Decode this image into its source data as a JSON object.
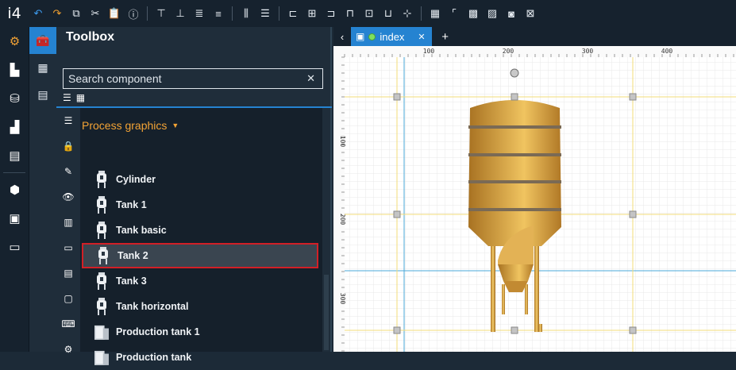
{
  "app": {
    "logo": "i4"
  },
  "toolbar": {
    "groups": [
      [
        {
          "name": "undo-icon",
          "glyph": "↶",
          "cls": "blue"
        },
        {
          "name": "redo-icon",
          "glyph": "↷",
          "cls": "orange"
        },
        {
          "name": "copy-icon",
          "glyph": "⧉",
          "cls": ""
        },
        {
          "name": "cut-icon",
          "glyph": "✂",
          "cls": ""
        },
        {
          "name": "paste-icon",
          "glyph": "📋",
          "cls": ""
        },
        {
          "name": "info-icon",
          "glyph": "ⓘ",
          "cls": ""
        }
      ],
      [
        {
          "name": "align-top-icon",
          "glyph": "⊤",
          "cls": ""
        },
        {
          "name": "align-bottom-icon",
          "glyph": "⊥",
          "cls": ""
        },
        {
          "name": "align-text-top-icon",
          "glyph": "≣",
          "cls": ""
        },
        {
          "name": "align-text-bottom-icon",
          "glyph": "≡",
          "cls": ""
        }
      ],
      [
        {
          "name": "distribute-horizontal-icon",
          "glyph": "⫼",
          "cls": ""
        },
        {
          "name": "distribute-vertical-icon",
          "glyph": "☰",
          "cls": ""
        }
      ],
      [
        {
          "name": "align-left-icon",
          "glyph": "⊏",
          "cls": ""
        },
        {
          "name": "align-center-icon",
          "glyph": "⊞",
          "cls": ""
        },
        {
          "name": "align-right-icon",
          "glyph": "⊐",
          "cls": ""
        },
        {
          "name": "align-top-edge-icon",
          "glyph": "⊓",
          "cls": ""
        },
        {
          "name": "align-middle-icon",
          "glyph": "⊡",
          "cls": ""
        },
        {
          "name": "align-bottom-edge-icon",
          "glyph": "⊔",
          "cls": ""
        },
        {
          "name": "center-icon",
          "glyph": "⊹",
          "cls": ""
        }
      ],
      [
        {
          "name": "grid-icon",
          "glyph": "▦",
          "cls": ""
        },
        {
          "name": "ruler-icon",
          "glyph": "⌜",
          "cls": ""
        },
        {
          "name": "snap-grid-icon",
          "glyph": "▩",
          "cls": ""
        },
        {
          "name": "guide-grid-icon",
          "glyph": "▨",
          "cls": ""
        },
        {
          "name": "snap-icon",
          "glyph": "◙",
          "cls": ""
        },
        {
          "name": "zoom-fit-icon",
          "glyph": "⊠",
          "cls": ""
        }
      ]
    ]
  },
  "leftbar": {
    "items": [
      {
        "name": "settings-gear-icon",
        "glyph": "⚙",
        "active": true
      },
      {
        "name": "dashboard-icon",
        "glyph": "▙",
        "active": false
      },
      {
        "name": "tank-icon",
        "glyph": "⛁",
        "active": false
      },
      {
        "name": "chart-icon",
        "glyph": "▟",
        "active": false
      },
      {
        "name": "server-icon",
        "glyph": "▤",
        "active": false
      },
      {
        "name": "package-icon",
        "glyph": "⬢",
        "active": false
      },
      {
        "name": "monitor-gear-icon",
        "glyph": "▣",
        "active": false
      },
      {
        "name": "window-icon",
        "glyph": "▭",
        "active": false
      }
    ]
  },
  "subbar": {
    "items": [
      {
        "name": "toolbox-icon",
        "glyph": "🧰",
        "active": true
      },
      {
        "name": "properties-icon",
        "glyph": "▦",
        "active": false
      },
      {
        "name": "document-icon",
        "glyph": "▤",
        "active": false
      }
    ]
  },
  "panel": {
    "title": "Toolbox",
    "search": {
      "placeholder": "Search component",
      "clear": "✕"
    },
    "view_toggles": [
      {
        "name": "list-view-icon",
        "glyph": "☰"
      },
      {
        "name": "grid-view-icon",
        "glyph": "▦"
      }
    ],
    "category_icons": [
      {
        "name": "list-category-icon",
        "glyph": "☰"
      },
      {
        "name": "lock-category-icon",
        "glyph": "🔒"
      },
      {
        "name": "edit-category-icon",
        "glyph": "✎"
      },
      {
        "name": "eye-category-icon",
        "glyph": "👁"
      },
      {
        "name": "lib-category-icon",
        "glyph": "▥"
      },
      {
        "name": "input-category-icon",
        "glyph": "▭"
      },
      {
        "name": "table-category-icon",
        "glyph": "▤"
      },
      {
        "name": "window-category-icon",
        "glyph": "▢"
      },
      {
        "name": "keyboard-category-icon",
        "glyph": "⌨"
      },
      {
        "name": "gears-category-icon",
        "glyph": "⚙"
      }
    ],
    "group_title": "Process graphics",
    "items": [
      {
        "label": "Cylinder",
        "icon": "tank",
        "selected": false
      },
      {
        "label": "Tank 1",
        "icon": "tank",
        "selected": false
      },
      {
        "label": "Tank basic",
        "icon": "tank",
        "selected": false
      },
      {
        "label": "Tank 2",
        "icon": "tank",
        "selected": true
      },
      {
        "label": "Tank 3",
        "icon": "tank",
        "selected": false
      },
      {
        "label": "Tank horizontal",
        "icon": "tank",
        "selected": false
      },
      {
        "label": "Production tank 1",
        "icon": "production",
        "selected": false
      },
      {
        "label": "Production tank",
        "icon": "production",
        "selected": false
      }
    ]
  },
  "tabs": {
    "nav_prev": "‹",
    "items": [
      {
        "label": "index",
        "close": "✕"
      }
    ],
    "add": "+"
  },
  "canvas": {
    "ruler_top_labels": [
      "100",
      "200",
      "300",
      "400"
    ],
    "ruler_left_labels": [
      "100",
      "200",
      "300"
    ],
    "colors": {
      "tank_body": "#d9a240",
      "tank_dark": "#a87222",
      "tank_light": "#f0c460",
      "band": "#7a6a55",
      "guide_yellow": "#f3dc7a",
      "guide_blue": "#4aa8d8",
      "grid": "#e6e6e6"
    }
  }
}
